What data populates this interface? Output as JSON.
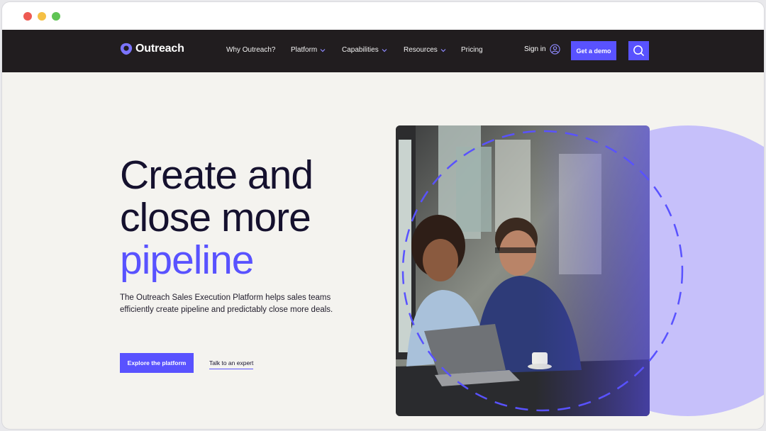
{
  "brand": {
    "name": "Outreach",
    "accent_color": "#5952ff",
    "nav_bg": "#211d1f"
  },
  "nav": {
    "items": [
      {
        "label": "Why Outreach?",
        "has_dropdown": false
      },
      {
        "label": "Platform",
        "has_dropdown": true
      },
      {
        "label": "Capabilities",
        "has_dropdown": true
      },
      {
        "label": "Resources",
        "has_dropdown": true
      },
      {
        "label": "Pricing",
        "has_dropdown": false
      }
    ],
    "sign_in": "Sign in",
    "demo_button": "Get a demo",
    "search_icon": "search-icon"
  },
  "hero": {
    "title_line1": "Create and",
    "title_line2": "close more",
    "title_accent": "pipeline",
    "subtitle": "The Outreach Sales Execution Platform helps sales teams efficiently create pipeline and predictably close more deals.",
    "primary_cta": "Explore the platform",
    "secondary_cta": "Talk to an expert"
  }
}
